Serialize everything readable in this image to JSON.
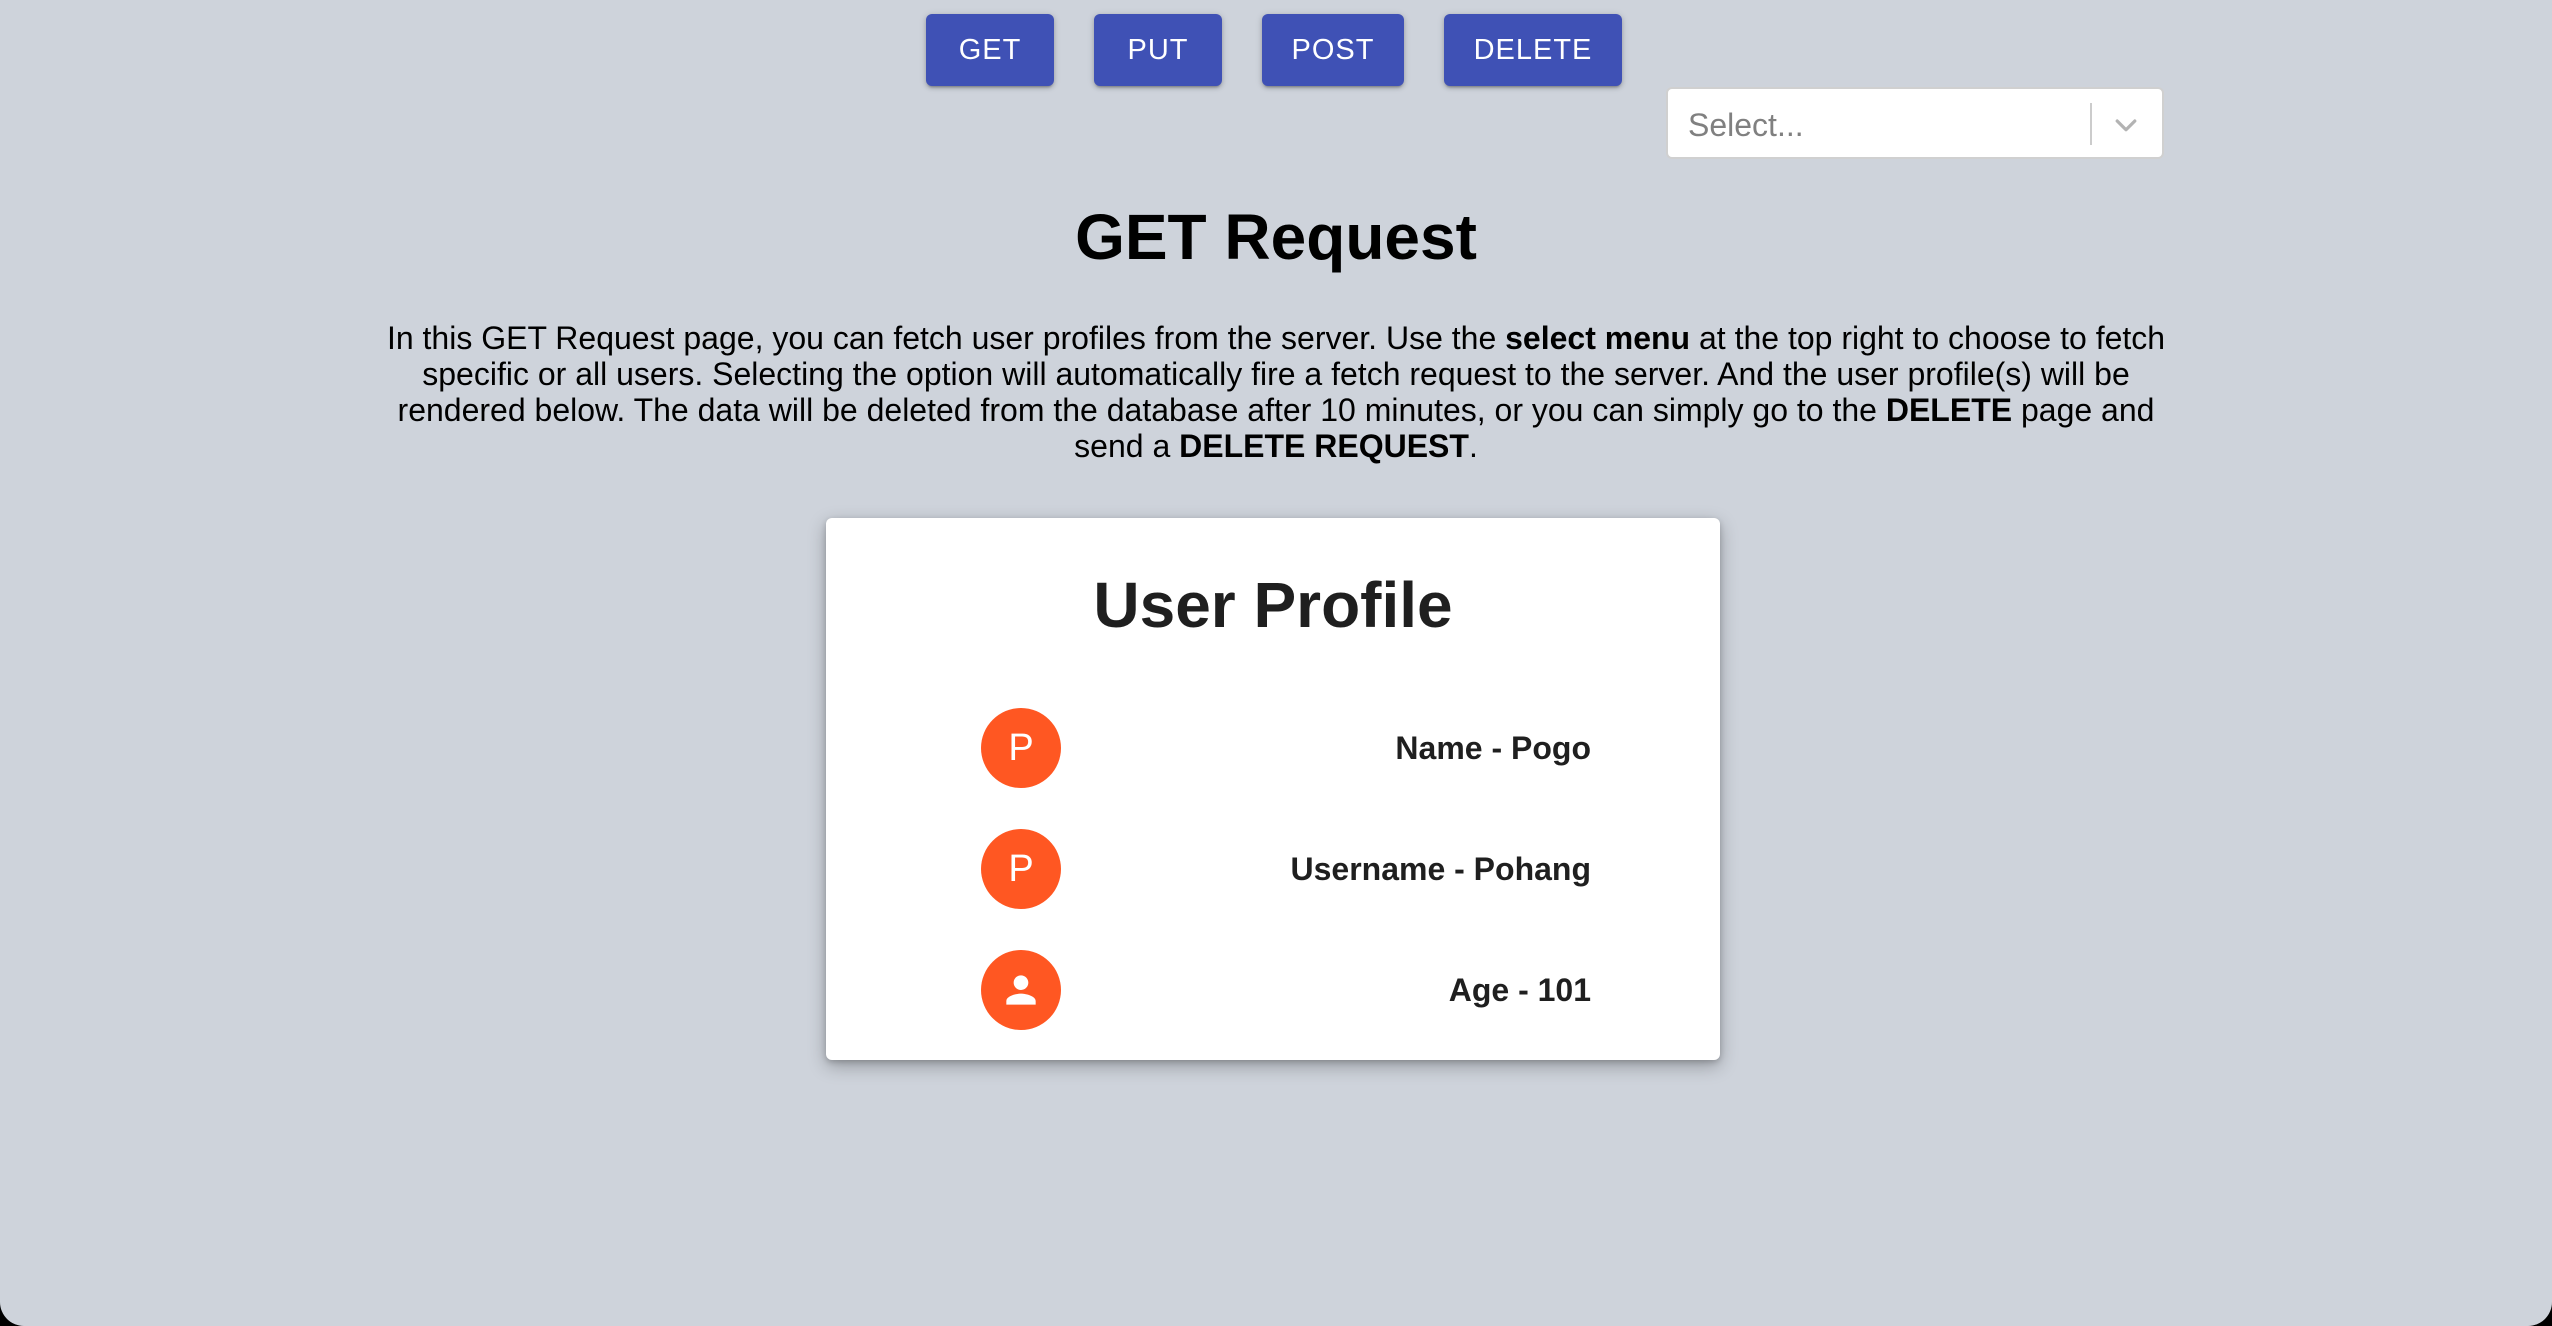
{
  "nav": {
    "buttons": [
      {
        "label": "GET"
      },
      {
        "label": "PUT"
      },
      {
        "label": "POST"
      },
      {
        "label": "DELETE"
      }
    ]
  },
  "select": {
    "placeholder": "Select...",
    "icon": "chevron-down-icon"
  },
  "page": {
    "title": "GET Request",
    "description": {
      "part1": "In this GET Request page, you can fetch user profiles from the server. Use the ",
      "bold1": "select menu",
      "part2": " at the top right to choose to fetch specific or all users. Selecting the option will automatically fire a fetch request to the server. And the user profile(s) will be rendered below. The data will be deleted from the database after 10 minutes, or you can simply go to the ",
      "bold2": "DELETE",
      "part3": " page and send a ",
      "bold3": "DELETE REQUEST",
      "part4": "."
    }
  },
  "profile": {
    "title": "User Profile",
    "rows": [
      {
        "avatar_letter": "P",
        "text": "Name - Pogo"
      },
      {
        "avatar_letter": "P",
        "text": "Username - Pohang"
      },
      {
        "avatar_icon": "person-icon",
        "text": "Age - 101"
      }
    ]
  },
  "colors": {
    "background": "#ced3db",
    "button": "#3f51b5",
    "avatar": "#ff5722",
    "card": "#ffffff"
  }
}
